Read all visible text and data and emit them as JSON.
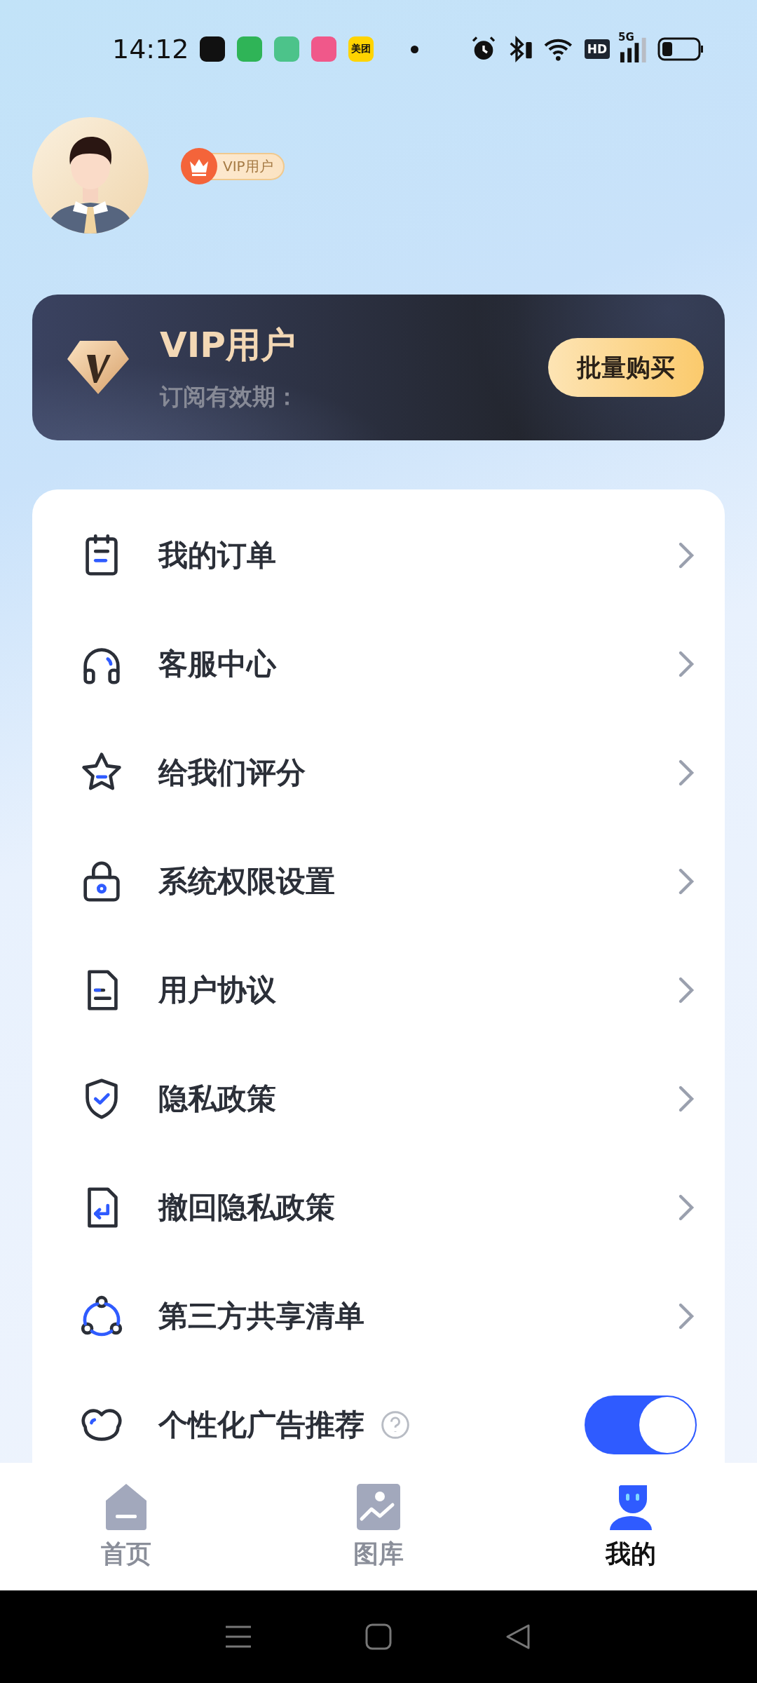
{
  "status_bar": {
    "time": "14:12",
    "notification_icons": [
      {
        "kind": "app",
        "color": "#111111"
      },
      {
        "kind": "app",
        "color": "#2fb457"
      },
      {
        "kind": "app",
        "color": "#4cc38a"
      },
      {
        "kind": "app",
        "color": "#f0588a"
      },
      {
        "kind": "text",
        "color": "#ffd400",
        "label": "美团"
      }
    ],
    "hd_label": "HD",
    "network_label": "5G"
  },
  "profile": {
    "badge": "VIP用户"
  },
  "vip_card": {
    "title": "VIP用户",
    "subtitle": "订阅有效期：",
    "button": "批量购买"
  },
  "menu": [
    {
      "kind": "link",
      "label": "我的订单"
    },
    {
      "kind": "link",
      "label": "客服中心"
    },
    {
      "kind": "link",
      "label": "给我们评分"
    },
    {
      "kind": "link",
      "label": "系统权限设置"
    },
    {
      "kind": "link",
      "label": "用户协议"
    },
    {
      "kind": "link",
      "label": "隐私政策"
    },
    {
      "kind": "link",
      "label": "撤回隐私政策"
    },
    {
      "kind": "link",
      "label": "第三方共享清单"
    },
    {
      "kind": "toggle",
      "label": "个性化广告推荐",
      "on": true
    }
  ],
  "tab_bar": [
    {
      "label": "首页",
      "selected": false
    },
    {
      "label": "图库",
      "selected": false
    },
    {
      "label": "我的",
      "selected": true
    }
  ]
}
